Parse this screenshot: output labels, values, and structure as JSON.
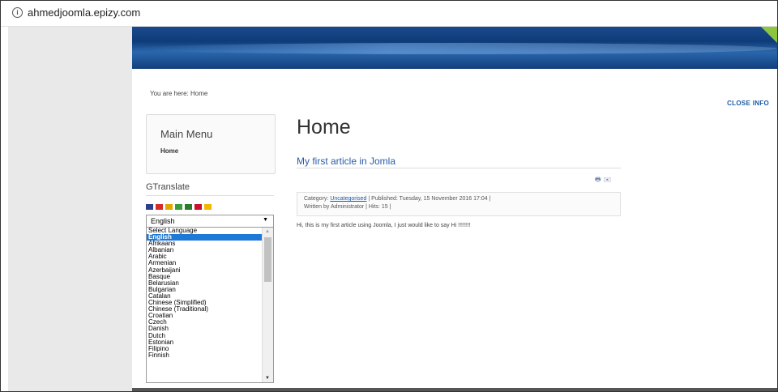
{
  "browser": {
    "url": "ahmedjoomla.epizy.com"
  },
  "breadcrumb": "You are here: Home",
  "close_info": "CLOSE INFO",
  "main_menu": {
    "title": "Main Menu",
    "items": [
      "Home"
    ]
  },
  "gtranslate": {
    "title": "GTranslate",
    "selected": "English",
    "flags": [
      {
        "name": "english-flag",
        "color": "#2b3f8c"
      },
      {
        "name": "french-flag",
        "color": "#d62b2b"
      },
      {
        "name": "german-flag",
        "color": "#e0a800"
      },
      {
        "name": "italian-flag",
        "color": "#3a9c3a"
      },
      {
        "name": "portuguese-flag",
        "color": "#2b7a2b"
      },
      {
        "name": "russian-flag",
        "color": "#c8102e"
      },
      {
        "name": "spanish-flag",
        "color": "#f2b600"
      }
    ],
    "options": [
      "Select Language",
      "English",
      "Afrikaans",
      "Albanian",
      "Arabic",
      "Armenian",
      "Azerbaijani",
      "Basque",
      "Belarusian",
      "Bulgarian",
      "Catalan",
      "Chinese (Simplified)",
      "Chinese (Traditional)",
      "Croatian",
      "Czech",
      "Danish",
      "Dutch",
      "Estonian",
      "Filipino",
      "Finnish"
    ]
  },
  "article": {
    "page_title": "Home",
    "title": "My first article in Jomla",
    "category_label": "Category:",
    "category": "Uncategorised",
    "published": "| Published: Tuesday, 15 November 2016 17:04 |",
    "written": "Written by Administrator | Hits: 15 |",
    "body": "Hi, this is my first article using Joomla, I just would like to say Hi !!!!!!!!"
  }
}
